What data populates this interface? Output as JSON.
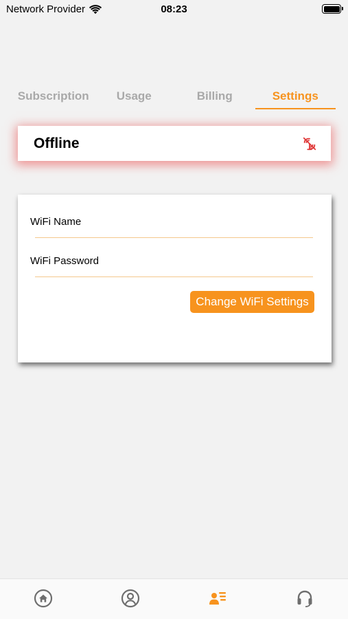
{
  "status_bar": {
    "carrier": "Network Provider",
    "time": "08:23"
  },
  "tabs": [
    {
      "label": "Subscription",
      "active": false
    },
    {
      "label": "Usage",
      "active": false
    },
    {
      "label": "Billing",
      "active": false
    },
    {
      "label": "Settings",
      "active": true
    }
  ],
  "connection": {
    "status": "Offline",
    "icon": "antenna-off-icon",
    "status_color": "#e03a3a"
  },
  "wifi_form": {
    "name_label": "WiFi Name",
    "name_value": "",
    "password_label": "WiFi Password",
    "password_value": "",
    "submit_label": "Change WiFi Settings"
  },
  "bottom_nav": [
    {
      "icon": "home-icon",
      "active": false
    },
    {
      "icon": "profile-icon",
      "active": false
    },
    {
      "icon": "account-list-icon",
      "active": true
    },
    {
      "icon": "headset-icon",
      "active": false
    }
  ],
  "colors": {
    "accent": "#f7931e",
    "inactive": "#a9a9a9",
    "nav_icon": "#6e6e6e",
    "background": "#f2f2f2"
  }
}
